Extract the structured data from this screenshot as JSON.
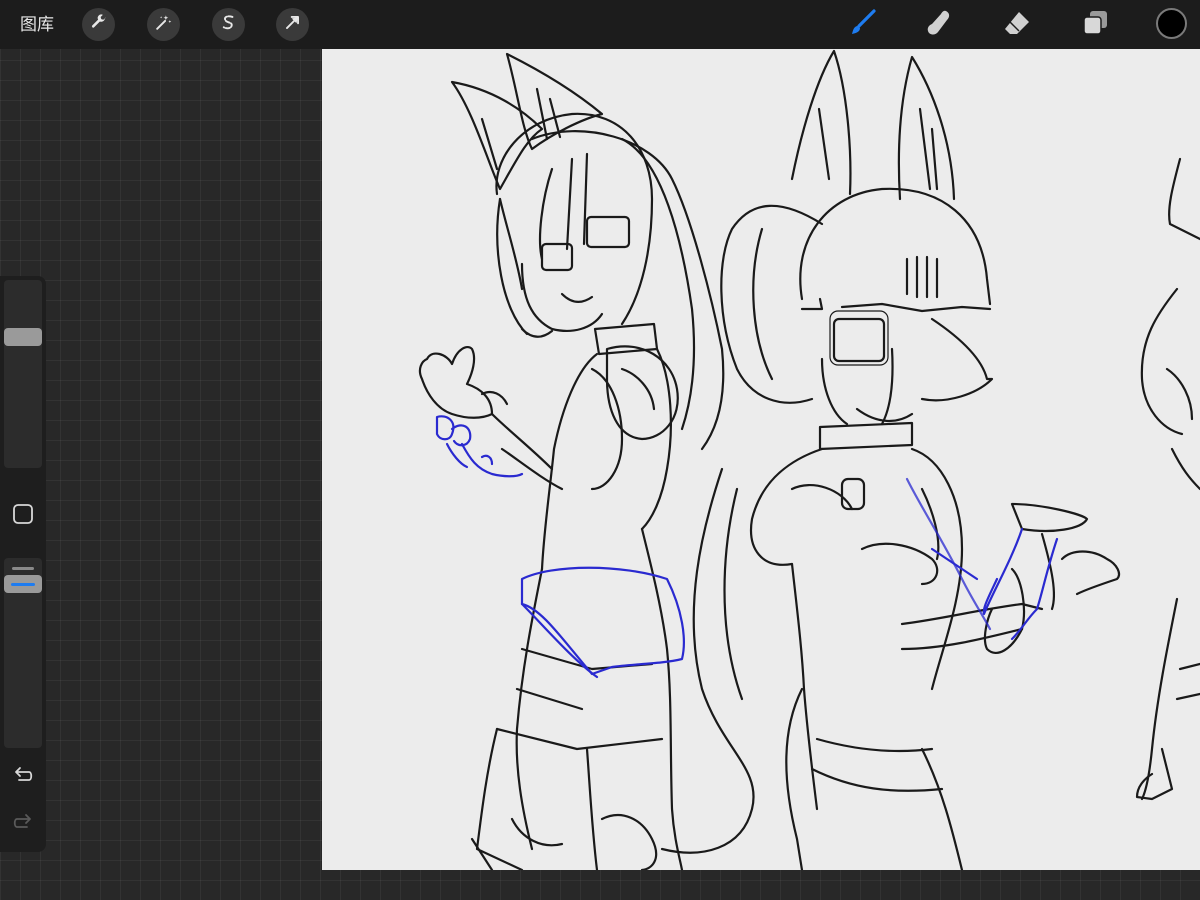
{
  "toolbar": {
    "gallery_label": "图库",
    "left_tools": [
      {
        "name": "actions",
        "icon": "wrench-icon"
      },
      {
        "name": "adjustments",
        "icon": "magic-wand-icon"
      },
      {
        "name": "selection",
        "icon": "selection-s-icon"
      },
      {
        "name": "transform",
        "icon": "arrow-cursor-icon"
      }
    ],
    "right_tools": [
      {
        "name": "brush",
        "icon": "brush-icon",
        "active": true
      },
      {
        "name": "smudge",
        "icon": "smudge-finger-icon",
        "active": false
      },
      {
        "name": "eraser",
        "icon": "eraser-icon",
        "active": false
      },
      {
        "name": "layers",
        "icon": "layers-icon",
        "active": false
      }
    ],
    "current_color": "#000000"
  },
  "sidebar": {
    "brush_size_level": 0.72,
    "opacity_level": 0.9,
    "undo_icon": "undo-arrow-icon",
    "redo_icon": "redo-arrow-icon",
    "modify_icon": "square-modify-icon"
  },
  "colors": {
    "accent": "#1e7cf0",
    "canvas": "#ececec",
    "line_art": "#1a1a1a",
    "sketch_blue": "#2a2ad0"
  }
}
